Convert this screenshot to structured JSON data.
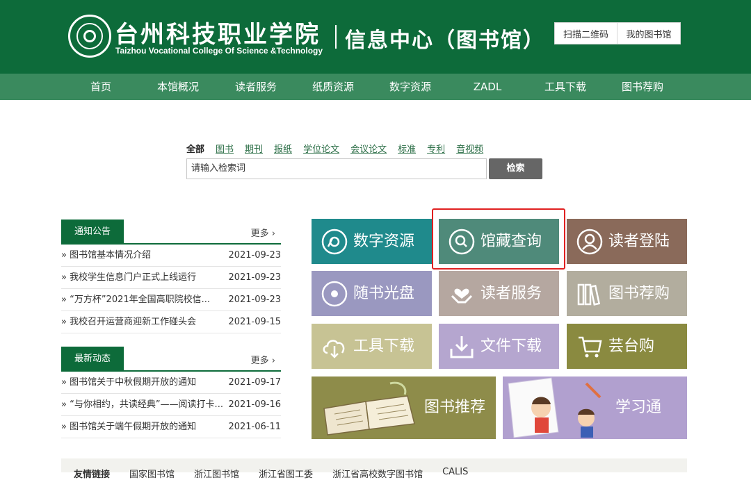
{
  "header": {
    "college_cn": "台州科技职业学院",
    "college_en": "Taizhou Vocational College Of Science &Technology",
    "center_title": "信息中心（图书馆）",
    "qr_button": "扫描二维码",
    "my_library_button": "我的图书馆"
  },
  "nav": {
    "items": [
      "首页",
      "本馆概况",
      "读者服务",
      "纸质资源",
      "数字资源",
      "ZADL",
      "工具下载",
      "图书荐购"
    ]
  },
  "search": {
    "tabs": [
      "全部",
      "图书",
      "期刊",
      "报纸",
      "学位论文",
      "会议论文",
      "标准",
      "专利",
      "音视频"
    ],
    "active_tab": "全部",
    "placeholder": "请输入检索词",
    "button": "检索"
  },
  "notices": {
    "title": "通知公告",
    "more": "更多 ›",
    "items": [
      {
        "text": "» 图书馆基本情况介绍",
        "date": "2021-09-23"
      },
      {
        "text": "» 我校学生信息门户正式上线运行",
        "date": "2021-09-23"
      },
      {
        "text": "» “万方杯”2021年全国高职院校信...",
        "date": "2021-09-23"
      },
      {
        "text": "» 我校召开运营商迎新工作碰头会",
        "date": "2021-09-15"
      }
    ]
  },
  "news": {
    "title": "最新动态",
    "more": "更多 ›",
    "items": [
      {
        "text": "» 图书馆关于中秋假期开放的通知",
        "date": "2021-09-17"
      },
      {
        "text": "» “与你相约，共读经典”——阅读打卡...",
        "date": "2021-09-16"
      },
      {
        "text": "» 图书馆关于端午假期开放的通知",
        "date": "2021-06-11"
      }
    ]
  },
  "tiles": [
    {
      "label": "数字资源",
      "icon": "disc-icon",
      "color": "#1f8a8c"
    },
    {
      "label": "馆藏查询",
      "icon": "search-icon",
      "color": "#4f8a7a"
    },
    {
      "label": "读者登陆",
      "icon": "user-icon",
      "color": "#8a6a5a"
    },
    {
      "label": "随书光盘",
      "icon": "cd-icon",
      "color": "#9a98c0"
    },
    {
      "label": "读者服务",
      "icon": "heart-hands-icon",
      "color": "#b5a7a0"
    },
    {
      "label": "图书荐购",
      "icon": "books-icon",
      "color": "#b2ad9e"
    },
    {
      "label": "工具下载",
      "icon": "cloud-download-icon",
      "color": "#c7c394"
    },
    {
      "label": "文件下载",
      "icon": "download-icon",
      "color": "#b5a6cf"
    },
    {
      "label": "芸台购",
      "icon": "cart-icon",
      "color": "#8a8a40"
    }
  ],
  "banners": [
    {
      "label": "图书推荐",
      "icon": "open-book-illustration",
      "color": "#8e8c4a"
    },
    {
      "label": "学习通",
      "icon": "study-illustration",
      "color": "#b1a0cf"
    }
  ],
  "links": {
    "title": "友情链接",
    "items": [
      "国家图书馆",
      "浙江图书馆",
      "浙江省图工委",
      "浙江省高校数字图书馆",
      "CALIS"
    ]
  }
}
